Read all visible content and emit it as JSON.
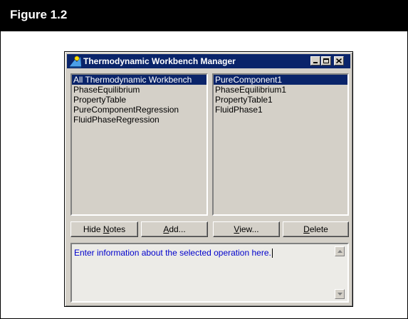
{
  "figure": {
    "title": "Figure 1.2"
  },
  "window": {
    "title": "Thermodynamic Workbench Manager",
    "controls": {
      "minimize_icon": "minimize-icon",
      "maximize_icon": "maximize-icon",
      "close_icon": "close-icon"
    }
  },
  "left_list": {
    "items": [
      {
        "label": "All Thermodynamic Workbench",
        "selected": true
      },
      {
        "label": "PhaseEquilibrium",
        "selected": false
      },
      {
        "label": "PropertyTable",
        "selected": false
      },
      {
        "label": "PureComponentRegression",
        "selected": false
      },
      {
        "label": "FluidPhaseRegression",
        "selected": false
      }
    ]
  },
  "right_list": {
    "items": [
      {
        "label": "PureComponent1",
        "selected": true
      },
      {
        "label": "PhaseEquilibrium1",
        "selected": false
      },
      {
        "label": "PropertyTable1",
        "selected": false
      },
      {
        "label": "FluidPhase1",
        "selected": false
      }
    ]
  },
  "buttons": {
    "hide_notes": {
      "prefix": "Hide ",
      "accel": "N",
      "suffix": "otes"
    },
    "add": {
      "prefix": "",
      "accel": "A",
      "suffix": "dd..."
    },
    "view": {
      "prefix": "",
      "accel": "V",
      "suffix": "iew..."
    },
    "delete": {
      "prefix": "",
      "accel": "D",
      "suffix": "elete"
    }
  },
  "notes": {
    "text": "Enter information about the selected operation here."
  },
  "colors": {
    "selection": "#0a246a",
    "titlebar": "#0a246a",
    "face": "#d4d0c8",
    "notes_text": "#0000cc"
  }
}
